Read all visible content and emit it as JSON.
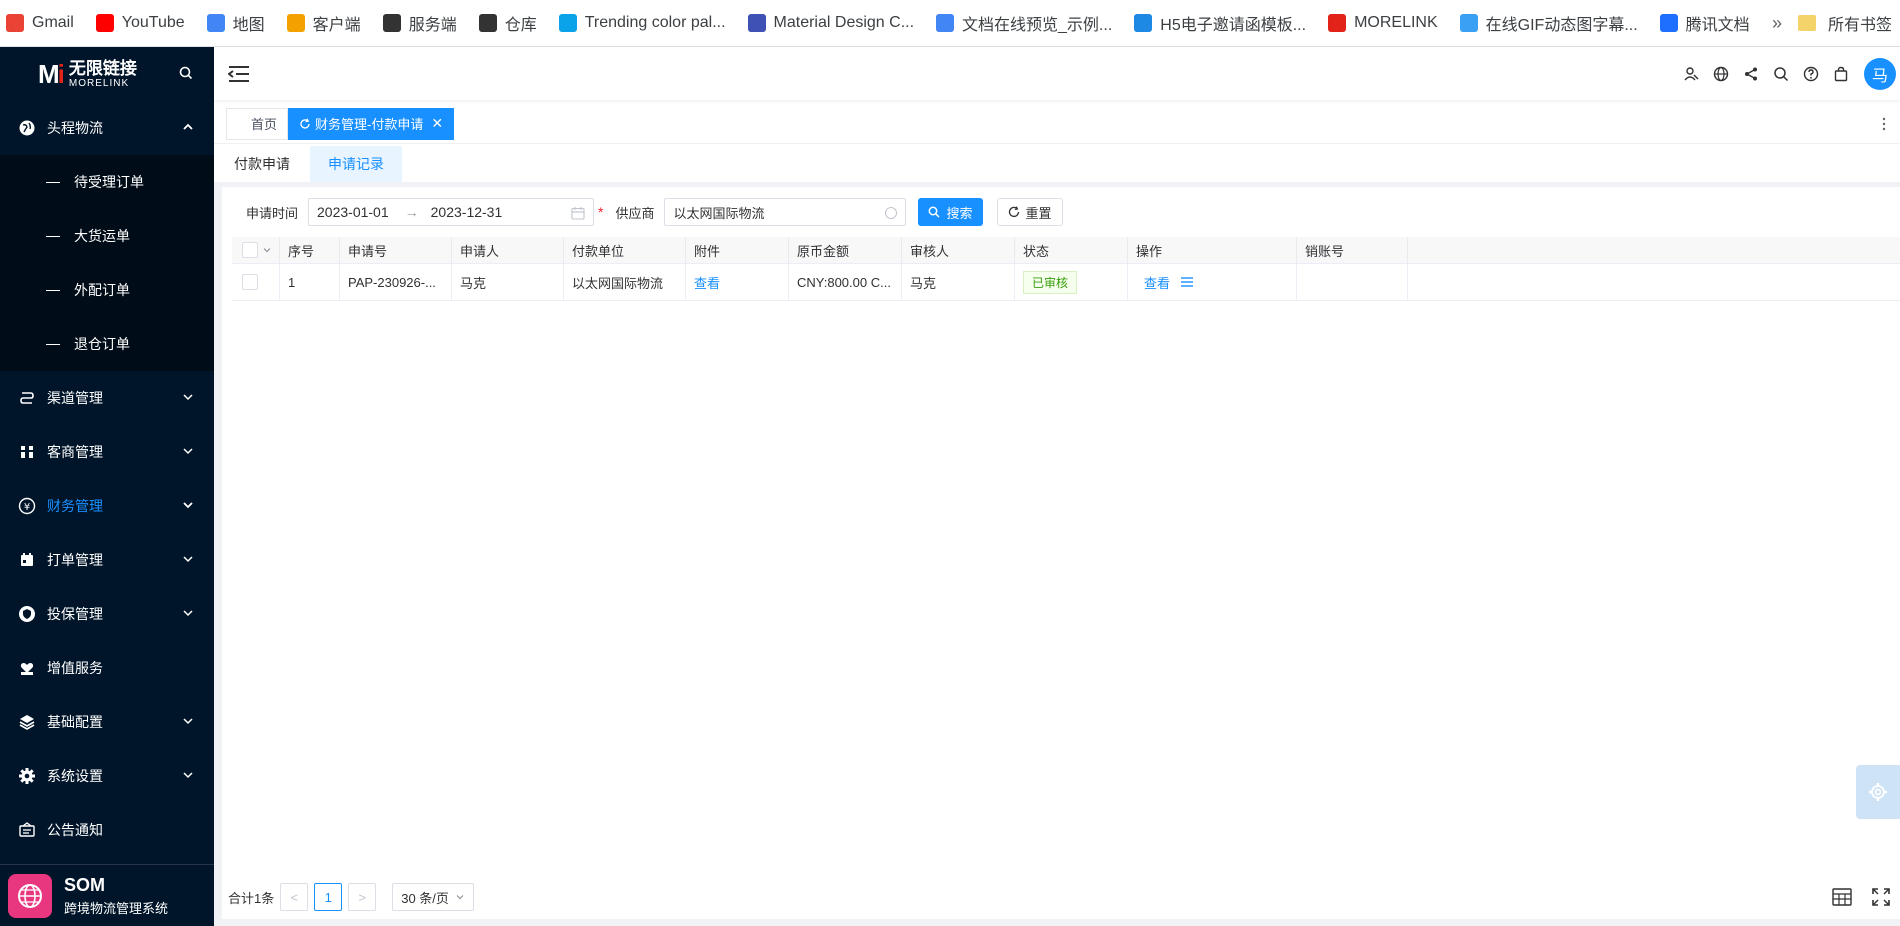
{
  "bookmarks": [
    {
      "label": "Gmail",
      "icon": "gmail-icon",
      "color": "#ea4335"
    },
    {
      "label": "YouTube",
      "icon": "youtube-icon",
      "color": "#ff0000"
    },
    {
      "label": "地图",
      "icon": "maps-icon",
      "color": "#4285f4"
    },
    {
      "label": "客户端",
      "icon": "client-icon",
      "color": "#f4a100"
    },
    {
      "label": "服务端",
      "icon": "morelink-icon",
      "color": "#333333"
    },
    {
      "label": "仓库",
      "icon": "morelink-icon",
      "color": "#333333"
    },
    {
      "label": "Trending color pal...",
      "icon": "coolors-icon",
      "color": "#0aa2e8"
    },
    {
      "label": "Material Design C...",
      "icon": "material-icon",
      "color": "#3f51b5"
    },
    {
      "label": "文档在线预览_示例...",
      "icon": "doc-icon",
      "color": "#4285f4"
    },
    {
      "label": "H5电子邀请函模板...",
      "icon": "infinity-icon",
      "color": "#1e88e5"
    },
    {
      "label": "MORELINK",
      "icon": "morelink-m-icon",
      "color": "#e2231a"
    },
    {
      "label": "在线GIF动态图字幕...",
      "icon": "gif-icon",
      "color": "#3aa0f3"
    },
    {
      "label": "腾讯文档",
      "icon": "tencent-docs-icon",
      "color": "#1e6fff"
    }
  ],
  "bookmarks_more": "»",
  "bookmarks_folder": "所有书签",
  "sidebar": {
    "logo_cn": "无限链接",
    "logo_en": "MORELINK",
    "menu": [
      {
        "label": "头程物流",
        "icon": "globe-icon",
        "expanded": true
      },
      {
        "label": "渠道管理",
        "icon": "route-icon"
      },
      {
        "label": "客商管理",
        "icon": "users-icon"
      },
      {
        "label": "财务管理",
        "icon": "yen-icon",
        "selected": true
      },
      {
        "label": "打单管理",
        "icon": "calendar-icon"
      },
      {
        "label": "投保管理",
        "icon": "shield-icon"
      },
      {
        "label": "增值服务",
        "icon": "heart-hand-icon"
      },
      {
        "label": "基础配置",
        "icon": "layers-icon"
      },
      {
        "label": "系统设置",
        "icon": "gear-icon"
      },
      {
        "label": "公告通知",
        "icon": "notice-icon"
      }
    ],
    "submenu": [
      "待受理订单",
      "大货运单",
      "外配订单",
      "退仓订单"
    ],
    "footer_title": "SOM",
    "footer_subtitle": "跨境物流管理系统"
  },
  "header": {
    "avatar_text": "马"
  },
  "tags": {
    "home": "首页",
    "active": "财务管理-付款申请"
  },
  "subtabs": [
    "付款申请",
    "申请记录"
  ],
  "filters": {
    "date_label": "申请时间",
    "start_date": "2023-01-01",
    "end_date": "2023-12-31",
    "date_sep": "→",
    "required_mark": "*",
    "supplier_label": "供应商",
    "supplier_value": "以太网国际物流",
    "search_label": "搜索",
    "reset_label": "重置"
  },
  "table": {
    "columns": [
      "序号",
      "申请号",
      "申请人",
      "付款单位",
      "附件",
      "原币金额",
      "审核人",
      "状态",
      "操作",
      "销账号"
    ],
    "rows": [
      {
        "index": "1",
        "app_no": "PAP-230926-...",
        "applicant": "马克",
        "payer": "以太网国际物流",
        "attachment": "查看",
        "amount": "CNY:800.00 C...",
        "reviewer": "马克",
        "status": "已审核",
        "action": "查看",
        "writeoff": ""
      }
    ]
  },
  "pager": {
    "total": "合计1条",
    "prev": "<",
    "current": "1",
    "next": ">",
    "page_size": "30 条/页"
  },
  "colors": {
    "sidebar_bg": "#001529",
    "primary": "#1890ff",
    "success": "#52c41a"
  }
}
